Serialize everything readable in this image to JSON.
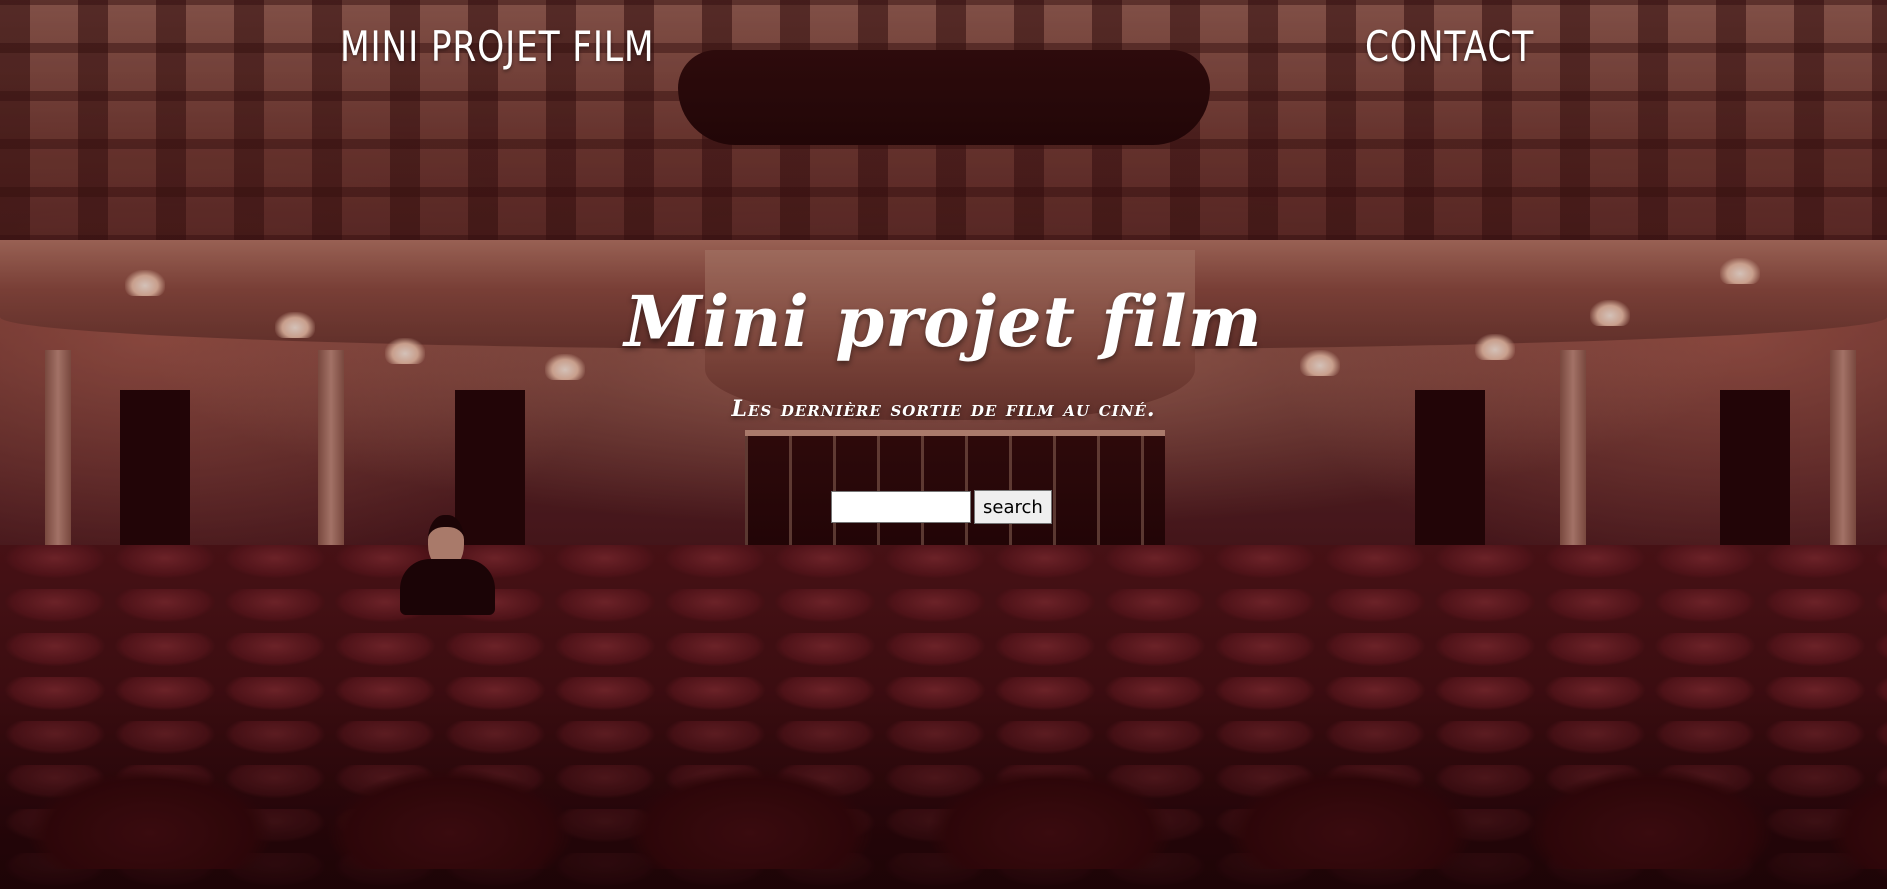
{
  "nav": {
    "brand": "MINI PROJET FILM",
    "contact": "CONTACT"
  },
  "hero": {
    "title": "Mini projet film",
    "subtitle": "Les dernière sortie de film au ciné."
  },
  "search": {
    "value": "",
    "placeholder": "",
    "button_label": "search"
  },
  "colors": {
    "text": "#ffffff",
    "background_tint": "#5a2a28"
  }
}
